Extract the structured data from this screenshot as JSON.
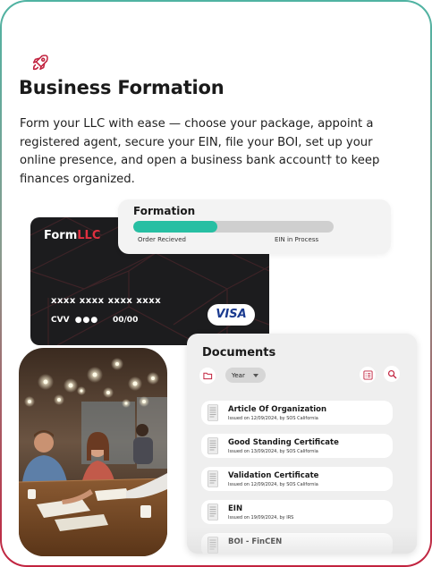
{
  "header": {
    "icon": "rocket-icon",
    "title": "Business Formation",
    "description": "Form your LLC with ease — choose your package, appoint a registered agent, secure your EIN, file your BOI, set up your online presence, and open a business bank account† to keep finances organized."
  },
  "card": {
    "brand_part1": "Form",
    "brand_part2": "LLC",
    "number": "xxxx xxxx xxxx xxxx",
    "cvv_label": "CVV",
    "cvv_dots": "●●●",
    "expiry": "00/00",
    "network": "VISA"
  },
  "formation": {
    "title": "Formation",
    "progress": 0.42,
    "step_done": "Order Recieved",
    "step_next": "EIN in Process"
  },
  "documents": {
    "title": "Documents",
    "filter_label": "Year",
    "items": [
      {
        "name": "Article Of Organization",
        "meta": "Issued on 12/09/2024, by SOS California"
      },
      {
        "name": "Good Standing Certificate",
        "meta": "Issued on 13/09/2024, by SOS California"
      },
      {
        "name": "Validation Certificate",
        "meta": "Issued on 12/09/2024, by SOS California"
      },
      {
        "name": "EIN",
        "meta": "Issued on 19/09/2024, by IRS"
      },
      {
        "name": "BOI - FinCEN",
        "meta": ""
      }
    ]
  },
  "colors": {
    "accent_teal": "#27bfa3",
    "accent_red": "#c2233f",
    "card_bg": "#1c1c1e"
  }
}
